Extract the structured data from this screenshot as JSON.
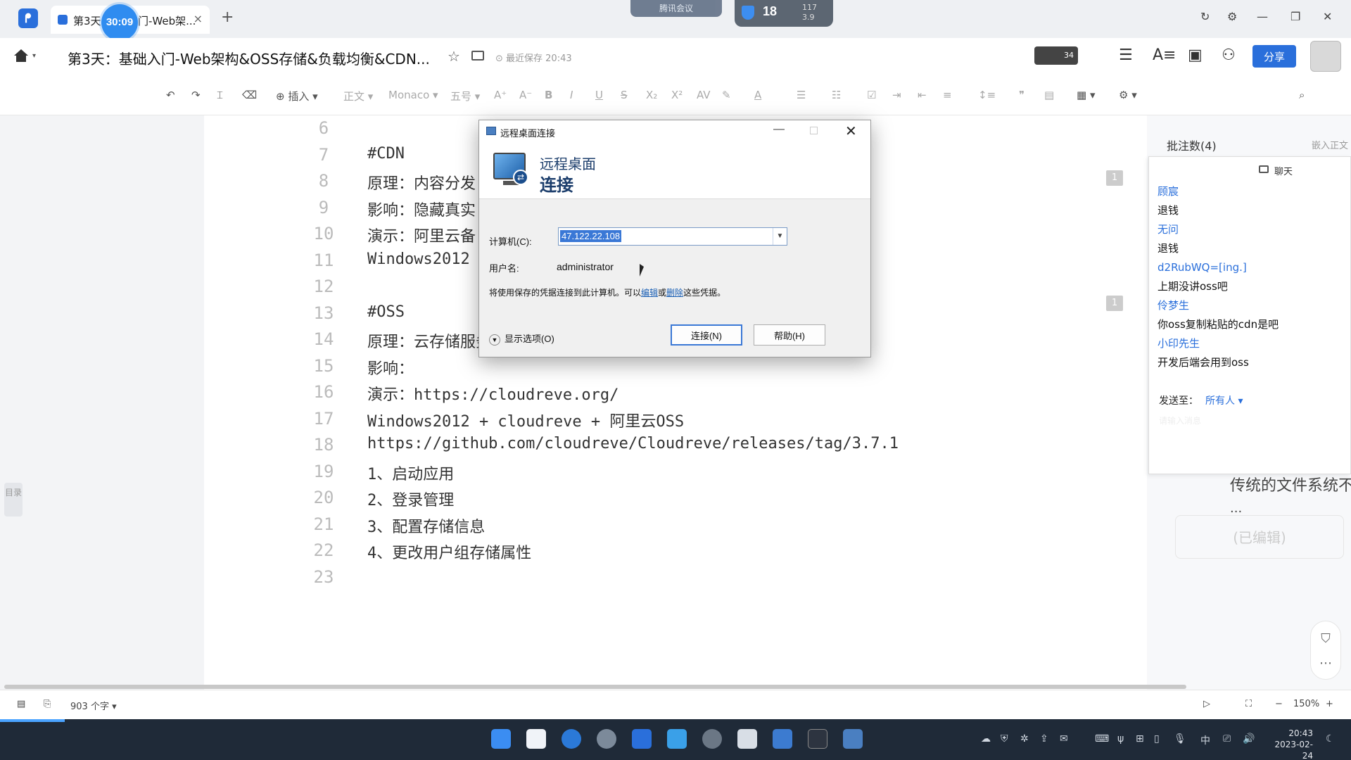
{
  "titlebar": {
    "tab_title": "第3天",
    "tab_title_suffix": "门-Web架...",
    "timer": "30:09",
    "meeting_label": "腾讯会议",
    "status_number": "18",
    "status_net": [
      "117",
      "3.9"
    ]
  },
  "docbar": {
    "title": "第3天：基础入门-Web架构&OSS存储&负载均衡&CDN...",
    "saved": "最近保存 20:43",
    "avatar_count": "34",
    "share_label": "分享"
  },
  "toolbar": {
    "insert": "插入",
    "style": "正文",
    "font": "Monaco",
    "size": "五号"
  },
  "editor": {
    "lines": [
      {
        "n": "6",
        "text": ""
      },
      {
        "n": "7",
        "text": "#CDN"
      },
      {
        "n": "8",
        "text": "原理：内容分发"
      },
      {
        "n": "9",
        "text": "影响：隐藏真实"
      },
      {
        "n": "10",
        "text": "演示：阿里云备"
      },
      {
        "n": "11",
        "text": "Windows2012"
      },
      {
        "n": "12",
        "text": ""
      },
      {
        "n": "13",
        "text": "#OSS"
      },
      {
        "n": "14",
        "text": "原理：云存储服务，旨在提高访问速度"
      },
      {
        "n": "15",
        "text": "影响："
      },
      {
        "n": "16",
        "text": "演示：https://cloudreve.org/"
      },
      {
        "n": "17",
        "text": "Windows2012 + cloudreve + 阿里云OSS"
      },
      {
        "n": "18",
        "text": "https://github.com/cloudreve/Cloudreve/releases/tag/3.7.1"
      },
      {
        "n": "19",
        "text": "1、启动应用"
      },
      {
        "n": "20",
        "text": "2、登录管理"
      },
      {
        "n": "21",
        "text": "3、配置存储信息"
      },
      {
        "n": "22",
        "text": "4、更改用户组存储属性"
      },
      {
        "n": "23",
        "text": ""
      }
    ],
    "comment_marks": [
      "1",
      "1"
    ],
    "outline_label": "目录"
  },
  "right_panel": {
    "comments_header": "批注数(4)",
    "embed_label": "嵌入正文",
    "ghost_text": "传统的文件系统不",
    "ghost_dots": "...",
    "ghost_edited": "(已编辑)"
  },
  "chat": {
    "header": "聊天",
    "messages": [
      {
        "user": "顾宸",
        "text": "退钱"
      },
      {
        "user": "无问",
        "text": "退钱"
      },
      {
        "user": "d2RubWQ=[ing.]",
        "text": "上期没讲oss吧"
      },
      {
        "user": "伶梦生",
        "text": "你oss复制粘贴的cdn是吧"
      },
      {
        "user": "小印先生",
        "text": "开发后端会用到oss"
      }
    ],
    "send_to_label": "发送至：",
    "send_to_target": "所有人",
    "input_placeholder": "请输入消息"
  },
  "statusbar": {
    "word_count": "903 个字",
    "zoom": "150%"
  },
  "taskbar": {
    "time": "20:43",
    "date": "2023-02-24",
    "ime": "中"
  },
  "rdp": {
    "window_title": "远程桌面连接",
    "banner_line1": "远程桌面",
    "banner_line2": "连接",
    "computer_label": "计算机(C):",
    "computer_value": "47.122.22.108",
    "user_label": "用户名:",
    "user_value": "administrator",
    "note_prefix": "将使用保存的凭据连接到此计算机。可以",
    "note_edit": "编辑",
    "note_or": "或",
    "note_delete": "删除",
    "note_suffix": "这些凭据。",
    "show_options": "显示选项(O)",
    "connect_button": "连接(N)",
    "help_button": "帮助(H)"
  },
  "colors": {
    "accent": "#2a6fdb",
    "chat_user": "#2a6fdb",
    "taskbar": "#1f2a38"
  }
}
